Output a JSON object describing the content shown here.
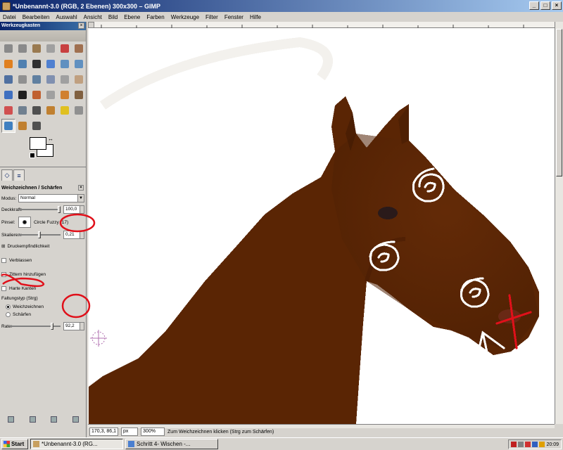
{
  "window": {
    "title": "*Unbenannt-3.0 (RGB, 2 Ebenen) 300x300 – GIMP",
    "buttons": [
      "_",
      "□",
      "×"
    ]
  },
  "menu": [
    "Datei",
    "Bearbeiten",
    "Auswahl",
    "Ansicht",
    "Bild",
    "Ebene",
    "Farben",
    "Werkzeuge",
    "Filter",
    "Fenster",
    "Hilfe"
  ],
  "toolbox": {
    "title": "Werkzeugkasten",
    "tool_colors": [
      "#8a8a8a",
      "#8a8a8a",
      "#9a7a50",
      "#a0a0a0",
      "#c84040",
      "#a07050",
      "#e08020",
      "#5080b0",
      "#303030",
      "#5080d0",
      "#6090c0",
      "#6090c0",
      "#5070a0",
      "#909090",
      "#6080a0",
      "#8090b0",
      "#a0a0a0",
      "#c0a080",
      "#4070c0",
      "#202020",
      "#c06030",
      "#a0a0a0",
      "#d08030",
      "#806040",
      "#d05050",
      "#708090",
      "#505050",
      "#c08030",
      "#e0c020",
      "#909090",
      "#4080c0",
      "#c08030",
      "#505050"
    ]
  },
  "tool_options": {
    "title": "Weichzeichnen / Schärfen",
    "mode_label": "Modus:",
    "mode_value": "Normal",
    "opacity_label": "Deckkraft:",
    "opacity_value": "100,0",
    "opacity_level": 1.0,
    "brush_label": "Pinsel:",
    "brush_value": "Circle Fuzzy (17)",
    "scale_label": "Skalieren:",
    "scale_value": "0,21",
    "pressure_label": "Druckempfindlichkeit",
    "fade_label": "Verblassen",
    "jitter_label": "Zittern hinzufügen",
    "hard_edge_label": "Harte Kanten",
    "convolve_label": "Faltungstyp (Strg)",
    "blur_label": "Weichzeichnen",
    "sharpen_label": "Schärfen",
    "rate_label": "Rate:",
    "rate_value": "92,2"
  },
  "status": {
    "coords": "170,3, 86,1",
    "unit": "px",
    "zoom": "300%",
    "message": "Zum Weichzeichnen klicken (Strg zum Schärfen)"
  },
  "taskbar": {
    "start": "Start",
    "items": [
      "*Unbenannt-3.0 (RG...",
      "Schritt 4- Wischen -..."
    ],
    "clock": "20:09"
  },
  "colors": {
    "horse": "#5a2504",
    "annotation_red": "#e0101a"
  }
}
